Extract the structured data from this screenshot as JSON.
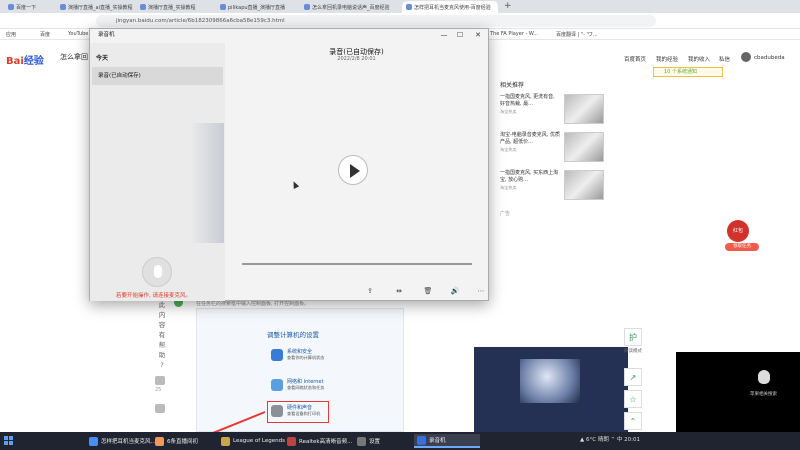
{
  "browser": {
    "tabs": [
      {
        "label": "百度一下"
      },
      {
        "label": "演播厅直播_ai直播_实操教程"
      },
      {
        "label": "演播厅直播_实操教程"
      },
      {
        "label": "pilikapu直播_演播厅直播"
      },
      {
        "label": "怎么拿回机录电脑说话声_百度经验"
      },
      {
        "label": "怎样把耳机当麦克风使用-百度经验"
      }
    ],
    "new_tab": "+",
    "url": "jingyan.baidu.com/article/6b182309866a6cba58e159c3.html",
    "bookmarks": [
      "应用",
      "百度",
      "YouTube",
      "The FA Player - W...",
      "百度翻译 | \"- 'ワ..."
    ]
  },
  "page": {
    "logo_a": "Bai",
    "logo_b": "经验",
    "search_text": "怎么拿回",
    "nav": [
      "百度首页",
      "我的经验",
      "我的收入",
      "私信",
      "cbadubeda"
    ],
    "notification": "10 个系统通知",
    "ads_header": "相关推荐",
    "ads": [
      {
        "text": "一指国麦克风, 更洗有音, 好音热裁, 最...",
        "source": "淘宝热卖"
      },
      {
        "text": "淘宝-电脑录音麦克风, 优质产品, 超低价...",
        "source": "淘宝热卖"
      },
      {
        "text": "一指国麦克风, 买东西上淘宝, 放心购...",
        "source": "淘宝热卖"
      }
    ],
    "ads_label": "广告",
    "red_packet": {
      "title": "红包",
      "label": "领取任务"
    },
    "helpful": [
      "此",
      "内",
      "容",
      "有",
      "帮",
      "助",
      "?"
    ],
    "helpful_count": "25",
    "step_text": "在任务栏的搜索框中输入控制面板, 打开控制面板。",
    "control_panel": {
      "title": "调整计算机的设置",
      "items": [
        {
          "name": "系统和安全",
          "sub": "查看你的计算机状态"
        },
        {
          "name": "网络和 Internet",
          "sub": "查看网络状态和任务"
        },
        {
          "name": "硬件和声音",
          "sub": "查看设备和打印机"
        }
      ]
    },
    "camera_text": "苹果相关搜索",
    "float_buttons": [
      "护",
      "↗",
      "☆",
      "⌃"
    ],
    "float_label": "阅读模式"
  },
  "recorder": {
    "title": "录音机",
    "list_header": "今天",
    "list_item": "录音(已自动保存)",
    "record_name": "录音(已自动保存)",
    "record_date": "2022/2/8 20:01",
    "hint": "若要开始操作, 请连接麦克风。",
    "tools": [
      "⇪",
      "⇹",
      "🗑",
      "🔊",
      "⋯"
    ]
  },
  "taskbar": {
    "items": [
      {
        "label": "怎样把耳机当麦克风...",
        "color": "#4d8cf5"
      },
      {
        "label": "6条直播间初",
        "color": "#e95"
      },
      {
        "label": "League of Legends",
        "color": "#c9a54b"
      },
      {
        "label": "Realtek高清晰音频...",
        "color": "#b44"
      },
      {
        "label": "设置",
        "color": "#777"
      },
      {
        "label": "录音机",
        "color": "#3a6fd8"
      }
    ],
    "tray": "▲  6°C 晴朗  ⌃ 中  20:01"
  }
}
